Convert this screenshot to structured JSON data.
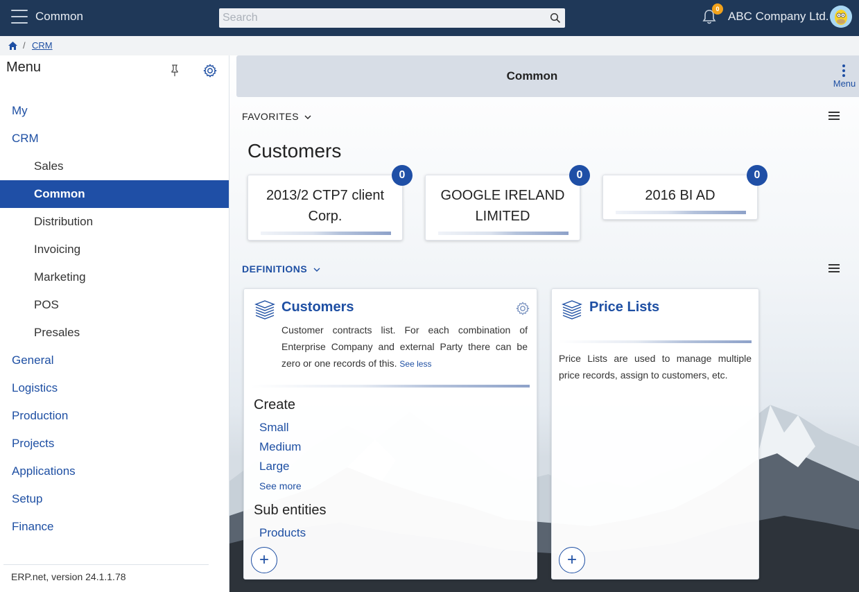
{
  "topbar": {
    "title": "Common",
    "search_placeholder": "Search",
    "notification_count": "0",
    "company": "ABC Company Ltd."
  },
  "breadcrumb": {
    "home_icon": "home-icon",
    "separator": "/",
    "current": "CRM"
  },
  "sidebar": {
    "title": "Menu",
    "items": [
      {
        "label": "My",
        "level": 1
      },
      {
        "label": "CRM",
        "level": 1
      },
      {
        "label": "Sales",
        "level": 2
      },
      {
        "label": "Common",
        "level": 2,
        "active": true
      },
      {
        "label": "Distribution",
        "level": 2
      },
      {
        "label": "Invoicing",
        "level": 2
      },
      {
        "label": "Marketing",
        "level": 2
      },
      {
        "label": "POS",
        "level": 2
      },
      {
        "label": "Presales",
        "level": 2
      },
      {
        "label": "General",
        "level": 1
      },
      {
        "label": "Logistics",
        "level": 1
      },
      {
        "label": "Production",
        "level": 1
      },
      {
        "label": "Projects",
        "level": 1
      },
      {
        "label": "Applications",
        "level": 1
      },
      {
        "label": "Setup",
        "level": 1
      },
      {
        "label": "Finance",
        "level": 1
      }
    ],
    "footer": "ERP.net, version 24.1.1.78"
  },
  "header": {
    "title": "Common",
    "menu_label": "Menu"
  },
  "favorites": {
    "label": "FAVORITES",
    "group_title": "Customers",
    "tiles": [
      {
        "line1": "2013/2 CTP7 client",
        "line2": "Corp.",
        "count": "0"
      },
      {
        "line1": "GOOGLE IRELAND",
        "line2": "LIMITED",
        "count": "0"
      },
      {
        "line1": "2016 BI AD",
        "line2": "",
        "count": "0"
      }
    ]
  },
  "definitions": {
    "label": "DEFINITIONS",
    "cards": [
      {
        "title": "Customers",
        "description": "Customer contracts list. For each combination of Enterprise Company and external Party there can be zero or one records of this.",
        "see_less": "See less",
        "create_label": "Create",
        "create_links": [
          "Small",
          "Medium",
          "Large"
        ],
        "see_more": "See more",
        "sub_label": "Sub entities",
        "sub_links": [
          "Products"
        ],
        "add_symbol": "+"
      },
      {
        "title": "Price Lists",
        "description": "Price Lists are used to manage multiple price records, assign to customers, etc.",
        "add_symbol": "+"
      }
    ]
  },
  "colors": {
    "topbar": "#1f3858",
    "accent": "#1f4fa6",
    "link": "#1e4fa3",
    "badge": "#f2a21b"
  }
}
